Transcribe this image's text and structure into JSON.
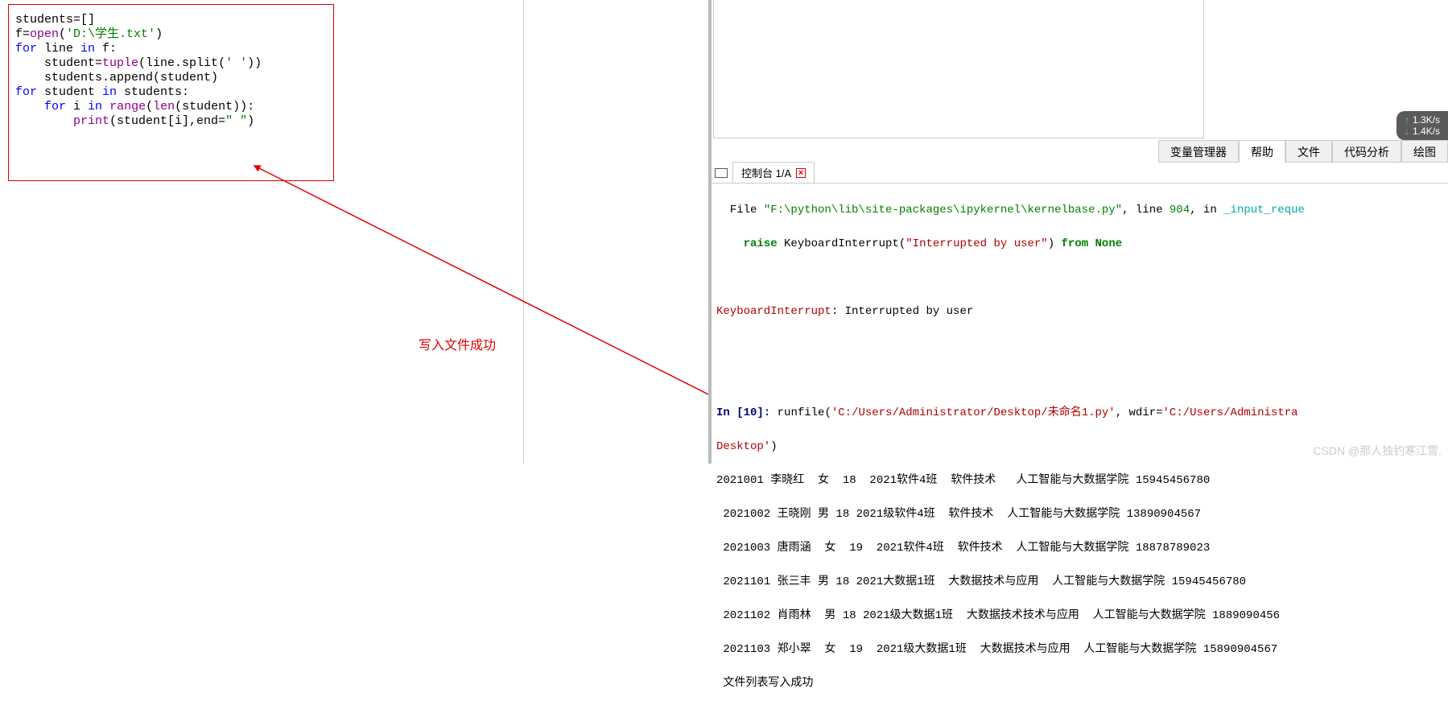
{
  "code": {
    "l1": "students=[]",
    "l2": "",
    "l3_open": "f=",
    "l3_fn": "open",
    "l3_str": "'D:\\学生.txt'",
    "l4_for": "for",
    "l4_rest": " line ",
    "l4_in": "in",
    "l4_end": " f:",
    "l5_indent": "    student=",
    "l5_tuple": "tuple",
    "l5_mid": "(line.split(",
    "l5_str": "' '",
    "l5_end": "))",
    "l6": "    students.append(student)",
    "l7": "",
    "l8_for": "for",
    "l8_mid": " student ",
    "l8_in": "in",
    "l8_end": " students:",
    "l9_indent": "    ",
    "l9_for": "for",
    "l9_mid": " i ",
    "l9_in": "in",
    "l9_end": " ",
    "l9_range": "range",
    "l9_paren": "(",
    "l9_len": "len",
    "l9_tail": "(student)):",
    "l10_indent": "        ",
    "l10_print": "print",
    "l10_mid": "(student[i],end=",
    "l10_str": "\" \"",
    "l10_end": ")"
  },
  "annotation": {
    "label": "写入文件成功"
  },
  "tabs": {
    "t1": "变量管理器",
    "t2": "帮助",
    "t3": "文件",
    "t4": "代码分析",
    "t5": "绘图"
  },
  "console_tab": {
    "label": "控制台 1/A"
  },
  "console": {
    "line1_a": "  File ",
    "line1_b": "\"F:\\python\\lib\\site-packages\\ipykernel\\kernelbase.py\"",
    "line1_c": ", line ",
    "line1_d": "904",
    "line1_e": ", in ",
    "line1_f": "_input_reque",
    "line2_a": "    raise",
    "line2_b": " KeyboardInterrupt(",
    "line2_c": "\"Interrupted by user\"",
    "line2_d": ") ",
    "line2_e": "from",
    "line2_f": " ",
    "line2_g": "None",
    "line4_a": "KeyboardInterrupt",
    "line4_b": ": Interrupted by user",
    "line7_a": "In [",
    "line7_b": "10",
    "line7_c": "]: ",
    "line7_d": "runfile(",
    "line7_e": "'C:/Users/Administrator/Desktop/未命名1.py'",
    "line7_f": ", wdir=",
    "line7_g": "'C:/Users/Administra",
    "line8_a": "Desktop'",
    "line8_b": ")",
    "row1": "2021001 李晓红  女  18  2021软件4班  软件技术   人工智能与大数据学院 15945456780",
    "row2": " 2021002 王晓刚 男 18 2021级软件4班  软件技术  人工智能与大数据学院 13890904567",
    "row3": " 2021003 唐雨涵  女  19  2021软件4班  软件技术  人工智能与大数据学院 18878789023",
    "row4": " 2021101 张三丰 男 18 2021大数据1班  大数据技术与应用  人工智能与大数据学院 15945456780",
    "row5": " 2021102 肖雨林  男 18 2021级大数据1班  大数据技术技术与应用  人工智能与大数据学院 1889090456",
    "row6": " 2021103 郑小翠  女  19  2021级大数据1班  大数据技术与应用  人工智能与大数据学院 15890904567",
    "row7": " 文件列表写入成功"
  },
  "speed": {
    "up": "1.3K/s",
    "down": "1.4K/s"
  },
  "watermark": "CSDN @那人独钓寒江雪."
}
